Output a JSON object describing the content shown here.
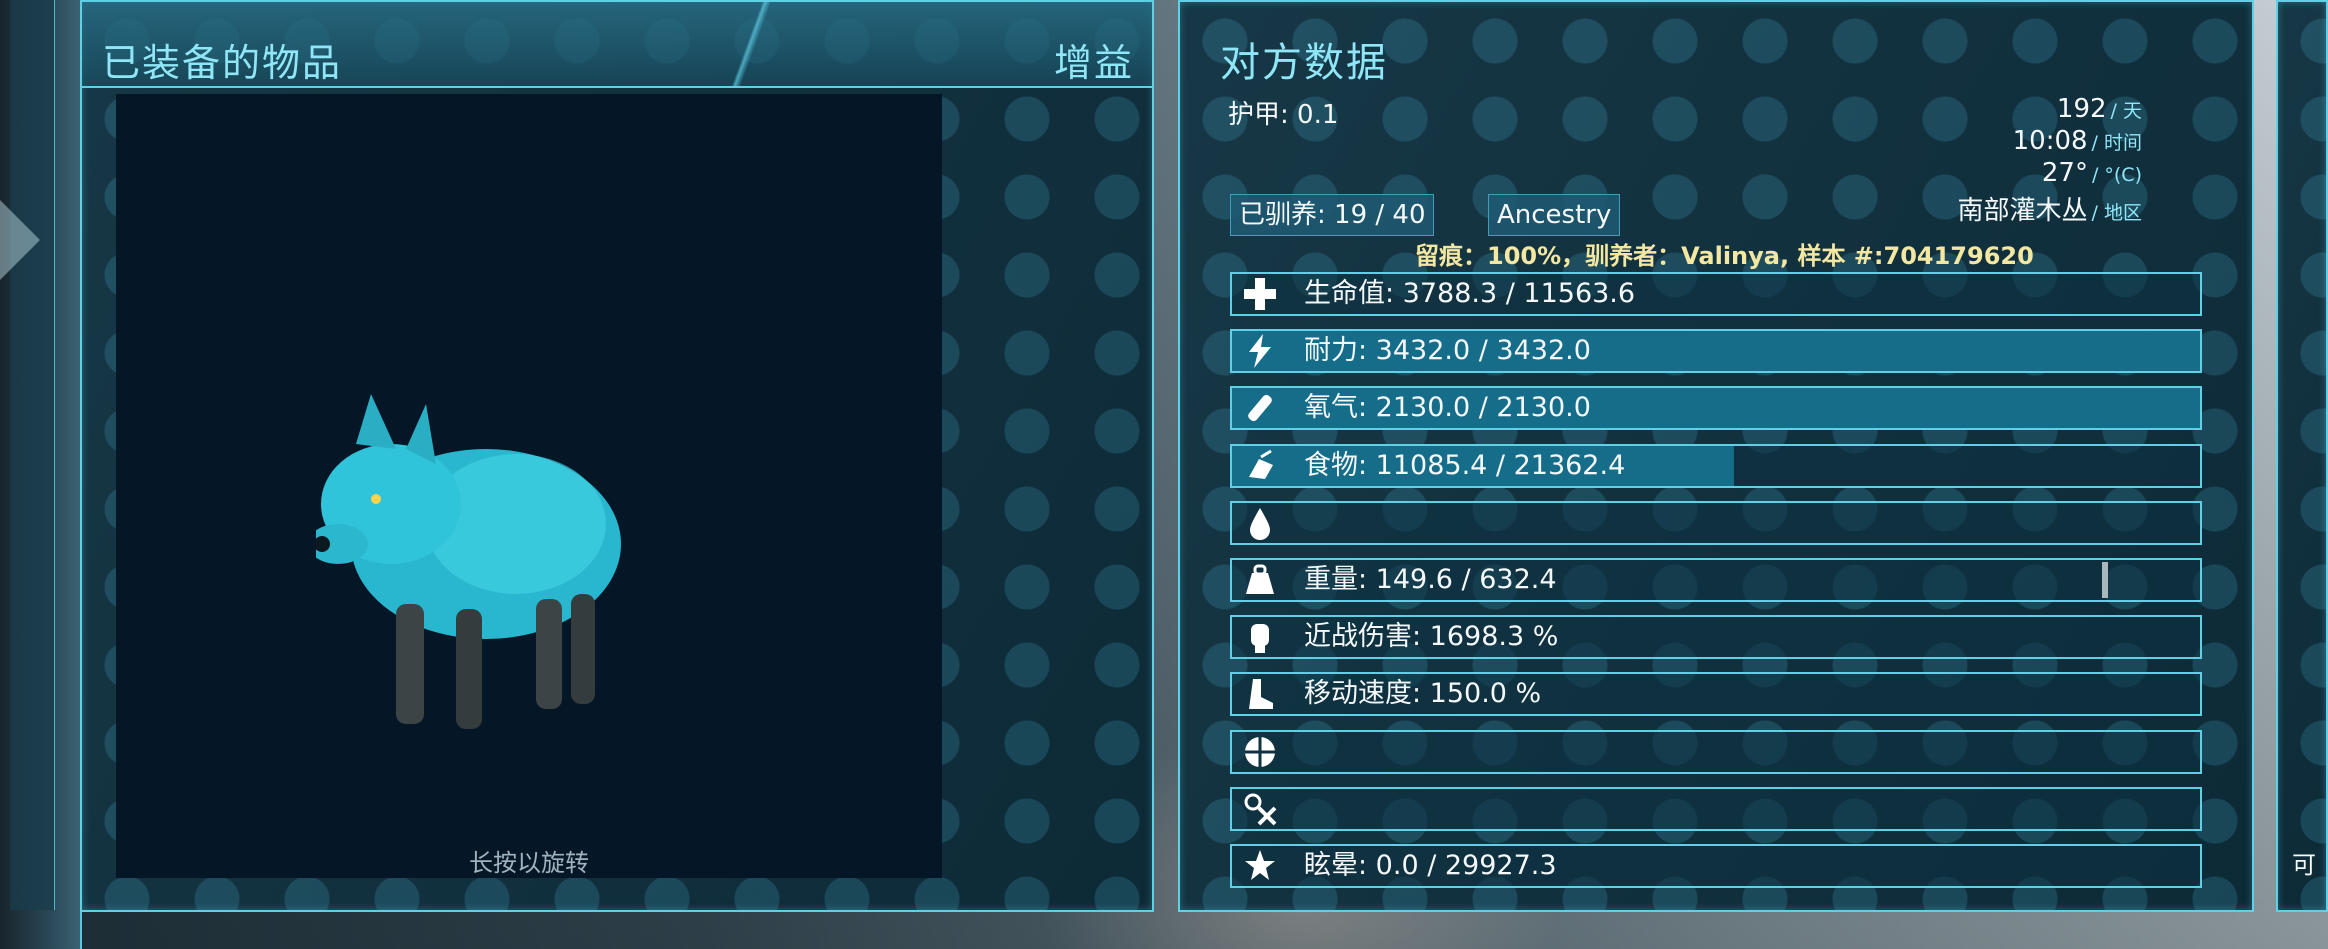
{
  "left_panel": {
    "title": "已装备的物品",
    "buff_tab": "增益",
    "rotate_hint": "长按以旋转"
  },
  "right_panel": {
    "title": "对方数据",
    "armor": "护甲: 0.1",
    "environment": {
      "day_value": "192",
      "day_unit": "/ 天",
      "time_value": "10:08",
      "time_unit": "/ 时间",
      "temp_value": "27°",
      "temp_unit": "/ °(C)",
      "region_value": "南部灌木丛",
      "region_unit": "/ 地区"
    },
    "tamed": "已驯养: 19 / 40",
    "ancestry_button": "Ancestry",
    "imprint": "留痕：100%，驯养者：Valinya, 样本 #:704179620",
    "stats": [
      {
        "name": "health",
        "icon": "health-icon",
        "label": "生命值: 3788.3 / 11563.6",
        "fill": 0.0
      },
      {
        "name": "stamina",
        "icon": "stamina-icon",
        "label": "耐力: 3432.0 / 3432.0",
        "fill": 1.0
      },
      {
        "name": "oxygen",
        "icon": "oxygen-icon",
        "label": "氧气: 2130.0 / 2130.0",
        "fill": 1.0
      },
      {
        "name": "food",
        "icon": "food-icon",
        "label": "食物: 11085.4 / 21362.4",
        "fill": 0.5189
      },
      {
        "name": "water",
        "icon": "water-icon",
        "label": "",
        "fill": 0.0
      },
      {
        "name": "weight",
        "icon": "weight-icon",
        "label": "重量: 149.6 / 632.4",
        "fill": 0.0
      },
      {
        "name": "melee",
        "icon": "melee-icon",
        "label": "近战伤害: 1698.3 %",
        "fill": 0.0
      },
      {
        "name": "speed",
        "icon": "speed-icon",
        "label": "移动速度: 150.0 %",
        "fill": 0.0
      },
      {
        "name": "fortitude",
        "icon": "fortitude-icon",
        "label": "",
        "fill": 0.0
      },
      {
        "name": "crafting",
        "icon": "crafting-icon",
        "label": "",
        "fill": 0.0
      },
      {
        "name": "torpor",
        "icon": "torpor-icon",
        "label": "眩晕: 0.0 / 29927.3",
        "fill": 0.0
      }
    ]
  },
  "far_right_panel": {
    "partial_label": "可"
  },
  "colors": {
    "accent": "#5fd0e6",
    "bar_fill": "#166d8a",
    "imprint_text": "#f3e7a2"
  }
}
